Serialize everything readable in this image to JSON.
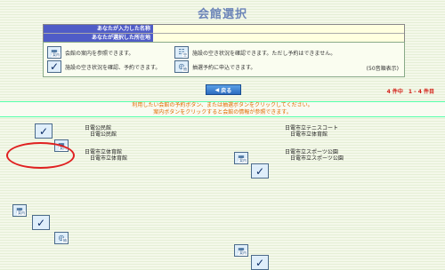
{
  "page_title": "会館選択",
  "search": {
    "name_label": "あなたが入力した名称",
    "name_value": "",
    "location_label": "あなたが選択した所在地",
    "location_value": ""
  },
  "legend": {
    "guide_text": "会館の案内を参照できます。",
    "availability_text": "施設の空き状況を確認できます。ただし予約はできません。",
    "reserve_text": "施設の空き状況を確認、予約できます。",
    "lottery_text": "抽選予約に申込できます。",
    "sort_text": "(50音順表示)"
  },
  "back_button_label": "戻る",
  "result_count": "4 件中　1 - 4 件目",
  "notice": {
    "line1": "利用したい会館の予約ボタン、または抽選ボタンをクリックしてください。",
    "line2": "案内ボタンをクリックすると会館の情報が参照できます。"
  },
  "halls": [
    {
      "name": "日電公民館",
      "sub": "日電公民館"
    },
    {
      "name": "日電市立テニスコート",
      "sub": "日電市立体育館"
    },
    {
      "name": "日電市立体育館",
      "sub": "日電市立体育館"
    },
    {
      "name": "日電市立スポーツ公園",
      "sub": "日電市立スポーツ公園"
    }
  ],
  "icons": {
    "guide": "guide-icon",
    "calendar": "calendar-view-icon",
    "reserve": "reserve-check-icon",
    "lottery": "lottery-icon"
  },
  "colors": {
    "title": "#6b84b8",
    "label_bg": "#4f5cc7",
    "notice_text": "#e06a00",
    "count_text": "#d4221a",
    "highlight": "#e02020"
  }
}
